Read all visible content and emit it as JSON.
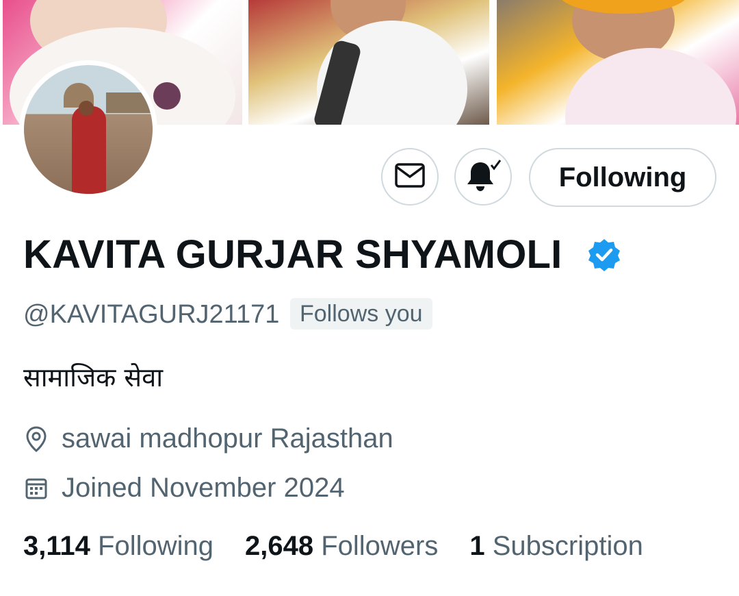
{
  "banner": {
    "photos": [
      "banner-photo-1",
      "banner-photo-2",
      "banner-photo-3"
    ]
  },
  "actions": {
    "message_icon": "mail-icon",
    "notification_icon": "bell-check-icon",
    "follow_label": "Following"
  },
  "profile": {
    "name": "KAVITA GURJAR SHYAMOLI",
    "verified": true,
    "handle": "@KAVITAGURJ21171",
    "follows_you": "Follows you",
    "bio": "सामाजिक सेवा",
    "location": "sawai madhopur Rajasthan",
    "joined": "Joined November 2024"
  },
  "stats": [
    {
      "count": "3,114",
      "label": "Following"
    },
    {
      "count": "2,648",
      "label": "Followers"
    },
    {
      "count": "1",
      "label": "Subscription"
    }
  ],
  "colors": {
    "text": "#0f1419",
    "secondary": "#536471",
    "border": "#cfd9de",
    "verified": "#1d9bf0"
  }
}
